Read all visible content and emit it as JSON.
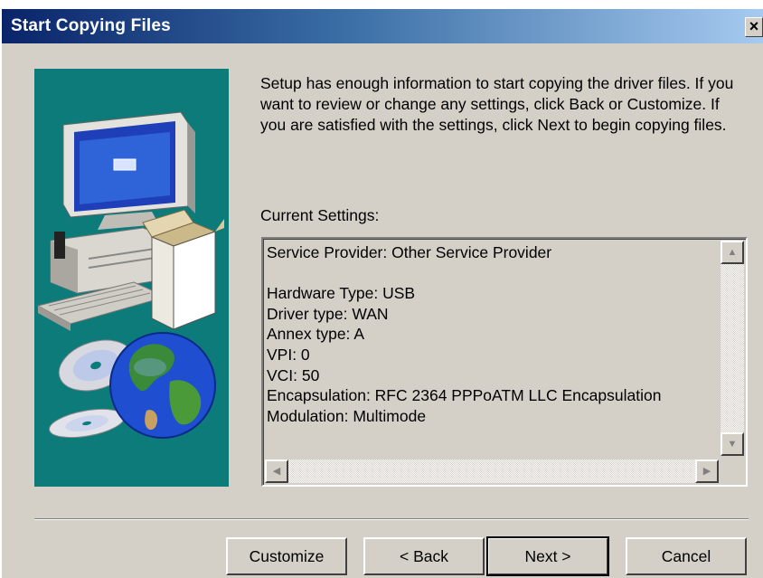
{
  "window": {
    "title": "Start Copying Files",
    "close_label": "×"
  },
  "intro_text": "Setup has enough information to start copying the driver files. If you want to review or change any settings, click Back or Customize.  If you are satisfied with the settings, click Next to begin copying files.",
  "settings": {
    "label": "Current Settings:",
    "lines": [
      "Service Provider: Other Service Provider",
      "",
      "Hardware Type: USB",
      "Driver type: WAN",
      "Annex type: A",
      "VPI: 0",
      "VCI: 50",
      "Encapsulation: RFC 2364 PPPoATM LLC Encapsulation",
      "Modulation: Multimode"
    ]
  },
  "buttons": {
    "customize": "Customize",
    "back": "< Back",
    "next": "Next >",
    "cancel": "Cancel"
  },
  "colors": {
    "art_background": "#0c7b7a",
    "dialog_face": "#d4d0c8",
    "title_start": "#0a246a",
    "title_end": "#a6caf0"
  },
  "icons": {
    "wizard_art": "computer-box-globe-cd-illustration",
    "scroll_up": "arrow-up-icon",
    "scroll_down": "arrow-down-icon",
    "scroll_left": "arrow-left-icon",
    "scroll_right": "arrow-right-icon"
  }
}
